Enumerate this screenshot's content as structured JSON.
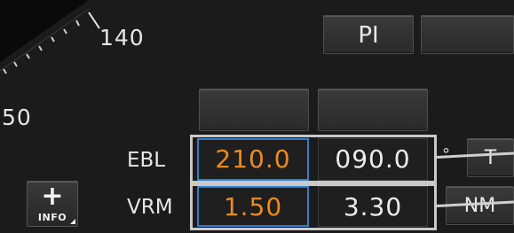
{
  "bearing_scale": {
    "label_upper": "140",
    "label_left": "50"
  },
  "top_buttons": {
    "pi_label": "PI",
    "blank_label": ""
  },
  "ebl": {
    "label": "EBL",
    "value_1": "210.0",
    "value_2": "090.0",
    "unit_symbol": "°",
    "mode_label": "T"
  },
  "vrm": {
    "label": "VRM",
    "value_1": "1.50",
    "value_2": "3.30",
    "unit_label": "NM"
  },
  "info_button": {
    "symbol": "+",
    "label": "INFO"
  },
  "colors": {
    "background": "#1b1b1b",
    "active_value": "#f08a1c",
    "inactive_value": "#ececec",
    "selection_border": "#2d7fd2"
  },
  "icons": [
    "plus-icon",
    "corner-triangle-icon"
  ]
}
